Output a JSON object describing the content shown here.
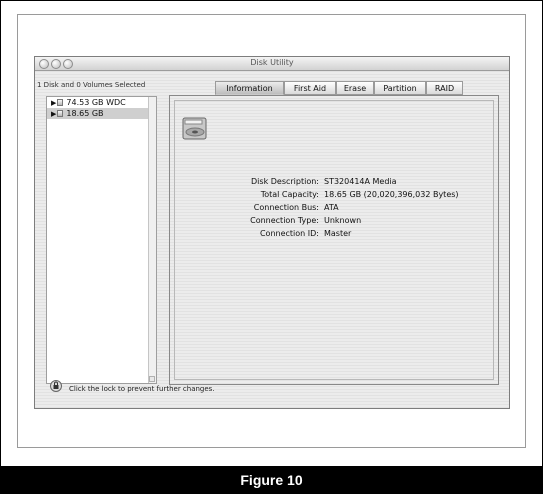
{
  "window": {
    "title": "Disk Utility",
    "selected_status": "1 Disk and 0 Volumes Selected"
  },
  "sidebar": {
    "disks": [
      {
        "label": "74.53 GB WDC",
        "icon": "drive-icon"
      },
      {
        "label": "18.65 GB",
        "icon": "drive-icon"
      }
    ]
  },
  "tabs": [
    {
      "label": "Information"
    },
    {
      "label": "First Aid"
    },
    {
      "label": "Erase"
    },
    {
      "label": "Partition"
    },
    {
      "label": "RAID"
    }
  ],
  "info": {
    "rows": [
      {
        "label": "Disk Description:",
        "value": "ST320414A Media"
      },
      {
        "label": "Total Capacity:",
        "value": "18.65 GB (20,020,396,032 Bytes)"
      },
      {
        "label": "Connection Bus:",
        "value": "ATA"
      },
      {
        "label": "Connection Type:",
        "value": "Unknown"
      },
      {
        "label": "Connection ID:",
        "value": "Master"
      }
    ]
  },
  "footer": {
    "lock_text": "Click the lock to prevent further changes."
  },
  "caption": "Figure 10"
}
